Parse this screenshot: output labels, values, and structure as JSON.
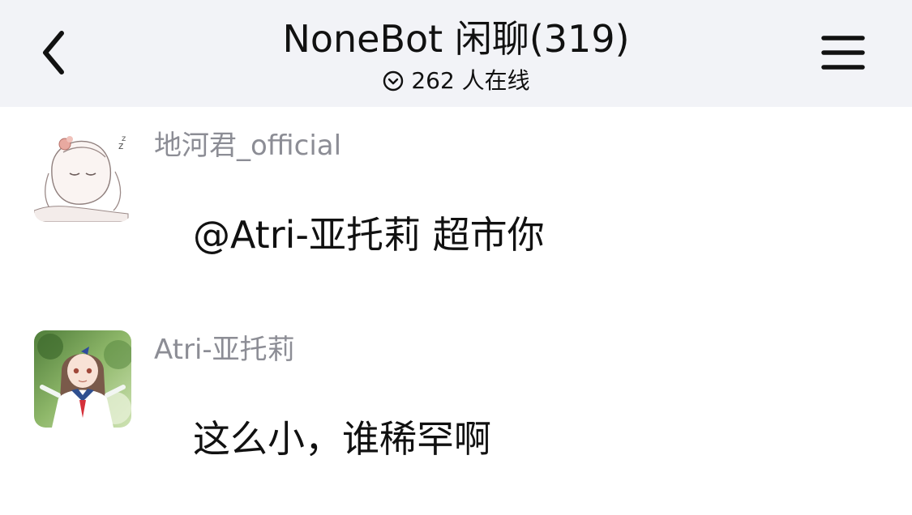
{
  "header": {
    "title": "NoneBot 闲聊(319)",
    "online_text": "262 人在线"
  },
  "messages": [
    {
      "sender": "地河君_official",
      "text": "@Atri-亚托莉 超市你",
      "avatar": "sleeping-anime-girl-avatar"
    },
    {
      "sender": "Atri-亚托莉",
      "text": "这么小，谁稀罕啊",
      "avatar": "anime-girl-sailor-uniform-avatar"
    }
  ],
  "colors": {
    "header_bg": "#f2f3f7",
    "sender_text": "#8c8d95",
    "body_text": "#111111",
    "background": "#ffffff"
  },
  "icons": {
    "back": "chevron-left-icon",
    "menu": "hamburger-menu-icon",
    "online": "circle-chevron-down-icon"
  }
}
